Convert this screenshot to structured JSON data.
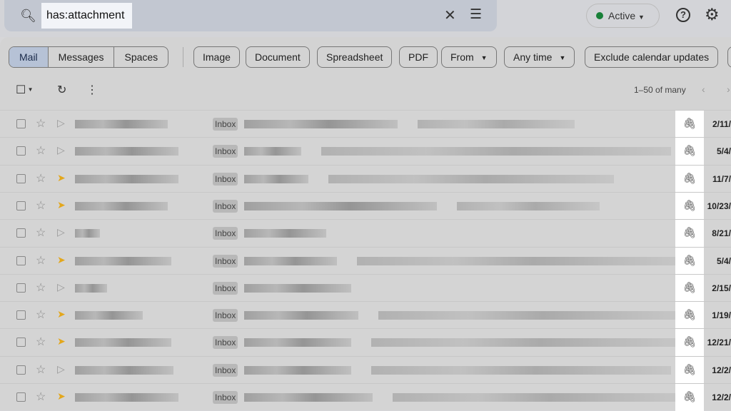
{
  "search": {
    "query": "has:attachment"
  },
  "status": {
    "label": "Active",
    "color": "#188038"
  },
  "tabs": [
    {
      "label": "Mail",
      "selected": true
    },
    {
      "label": "Messages"
    },
    {
      "label": "Spaces"
    }
  ],
  "chips": [
    {
      "label": "Image"
    },
    {
      "label": "Document"
    },
    {
      "label": "Spreadsheet"
    },
    {
      "label": "PDF"
    },
    {
      "label": "From",
      "dropdown": true
    },
    {
      "label": "Any time",
      "dropdown": true
    },
    {
      "label": "Exclude calendar updates"
    }
  ],
  "pagination": "1–50 of many",
  "rows": [
    {
      "label": "Inbox",
      "date": "2/11/",
      "important": false
    },
    {
      "label": "Inbox",
      "date": "5/4/",
      "important": false
    },
    {
      "label": "Inbox",
      "date": "11/7/",
      "important": true
    },
    {
      "label": "Inbox",
      "date": "10/23/",
      "important": true
    },
    {
      "label": "Inbox",
      "date": "8/21/",
      "important": false
    },
    {
      "label": "Inbox",
      "date": "5/4/",
      "important": true
    },
    {
      "label": "Inbox",
      "date": "2/15/",
      "important": false
    },
    {
      "label": "Inbox",
      "date": "1/19/",
      "important": true
    },
    {
      "label": "Inbox",
      "date": "12/21/",
      "important": true
    },
    {
      "label": "Inbox",
      "date": "12/2/",
      "important": false
    },
    {
      "label": "Inbox",
      "date": "12/2/",
      "important": true
    }
  ]
}
